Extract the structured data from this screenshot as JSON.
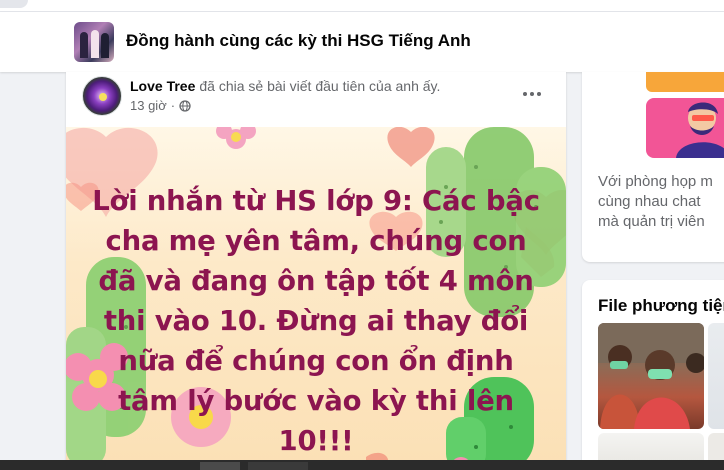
{
  "group": {
    "title": "Đồng hành cùng các kỳ thi HSG Tiếng Anh",
    "thumbnail_icon": "group-cover-photo"
  },
  "post": {
    "author": "Love Tree",
    "action": "đã chia sẻ bài viết đầu tiên của anh ấy.",
    "time": "13 giờ",
    "separator": "·",
    "privacy_icon": "public-globe-icon",
    "more_icon": "more-options-icon",
    "image_text": "Lời nhắn từ HS lớp 9: Các bậc cha mẹ yên tâm, chúng con đã và đang ôn tập tốt 4 môn thi vào 10. Đừng ai thay đổi nữa để chúng con ổn định tâm lý bước vào kỳ thi lên 10!!!"
  },
  "sidebar": {
    "rooms_text_lines": [
      "Với phòng họp m",
      "cùng nhau chat",
      "mà quản trị viên"
    ],
    "media_title": "File phương tiện"
  },
  "colors": {
    "quote_text": "#8c1550",
    "page_bg": "#f0f2f5",
    "card_bg": "#ffffff",
    "secondary_text": "#65676b"
  }
}
